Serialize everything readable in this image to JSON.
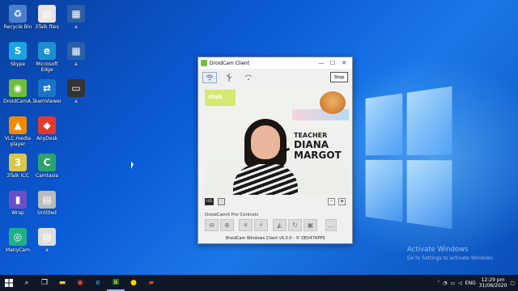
{
  "desktop_icons": [
    {
      "label": "Recycle Bin",
      "glyph": "♻",
      "color": "#4a7fd0"
    },
    {
      "label": "3Talk files",
      "glyph": "▤",
      "color": "#e6e6e6"
    },
    {
      "label": "a",
      "glyph": "▦",
      "color": "#2a5fa8"
    },
    {
      "label": "Skype",
      "glyph": "S",
      "color": "#1aa3e0"
    },
    {
      "label": "Microsoft Edge",
      "glyph": "e",
      "color": "#1d8fd1"
    },
    {
      "label": "a",
      "glyph": "▦",
      "color": "#2a5fa8"
    },
    {
      "label": "DroidCamA...",
      "glyph": "◉",
      "color": "#6fbf3c"
    },
    {
      "label": "TeamViewer",
      "glyph": "⇄",
      "color": "#1a73c9"
    },
    {
      "label": "a",
      "glyph": "▭",
      "color": "#333"
    },
    {
      "label": "VLC media player",
      "glyph": "▲",
      "color": "#f28a00"
    },
    {
      "label": "AnyDesk",
      "glyph": "◆",
      "color": "#e23a2e"
    },
    {
      "label": "3Talk ICC",
      "glyph": "3",
      "color": "#d8c94a"
    },
    {
      "label": "Camtasia",
      "glyph": "C",
      "color": "#2aa46a"
    },
    {
      "label": "Wrap",
      "glyph": "▮",
      "color": "#6b4fc9"
    },
    {
      "label": "Untitled",
      "glyph": "▤",
      "color": "#bbb"
    },
    {
      "label": "ManyCam",
      "glyph": "◎",
      "color": "#1fb08a"
    },
    {
      "label": "a",
      "glyph": "▤",
      "color": "#ddd"
    }
  ],
  "window": {
    "title": "DroidCam Client",
    "controls": {
      "minimize": "—",
      "maximize": "☐",
      "close": "✕"
    },
    "toolbar": {
      "wifi": "wifi-icon",
      "usb": "usb-icon",
      "wifi_server": "wifi-server-icon",
      "stop": "Stop"
    },
    "video": {
      "poster_text": "3Talk",
      "teacher_label": "TEACHER",
      "name_line1": "DIANA",
      "name_line2": "MARGOT"
    },
    "video_controls": {
      "hd": "HD",
      "zoom_out": "-",
      "zoom_in": "+"
    },
    "pro_controls_label": "DroidCamX Pro Controls",
    "pro_buttons": [
      "zoom-out-icon",
      "zoom-in-icon",
      "brightness-icon",
      "flash-icon",
      "mirror-icon",
      "rotate-icon",
      "save-icon",
      "more-icon"
    ],
    "footer": "DroidCam Windows Client v6.0.0 - © DEV47APPS"
  },
  "watermark": {
    "line1": "Activate Windows",
    "line2": "Go to Settings to activate Windows."
  },
  "taskbar": {
    "tray": {
      "lang": "ENG",
      "time": "12:29 pm",
      "date": "31/08/2020"
    }
  }
}
